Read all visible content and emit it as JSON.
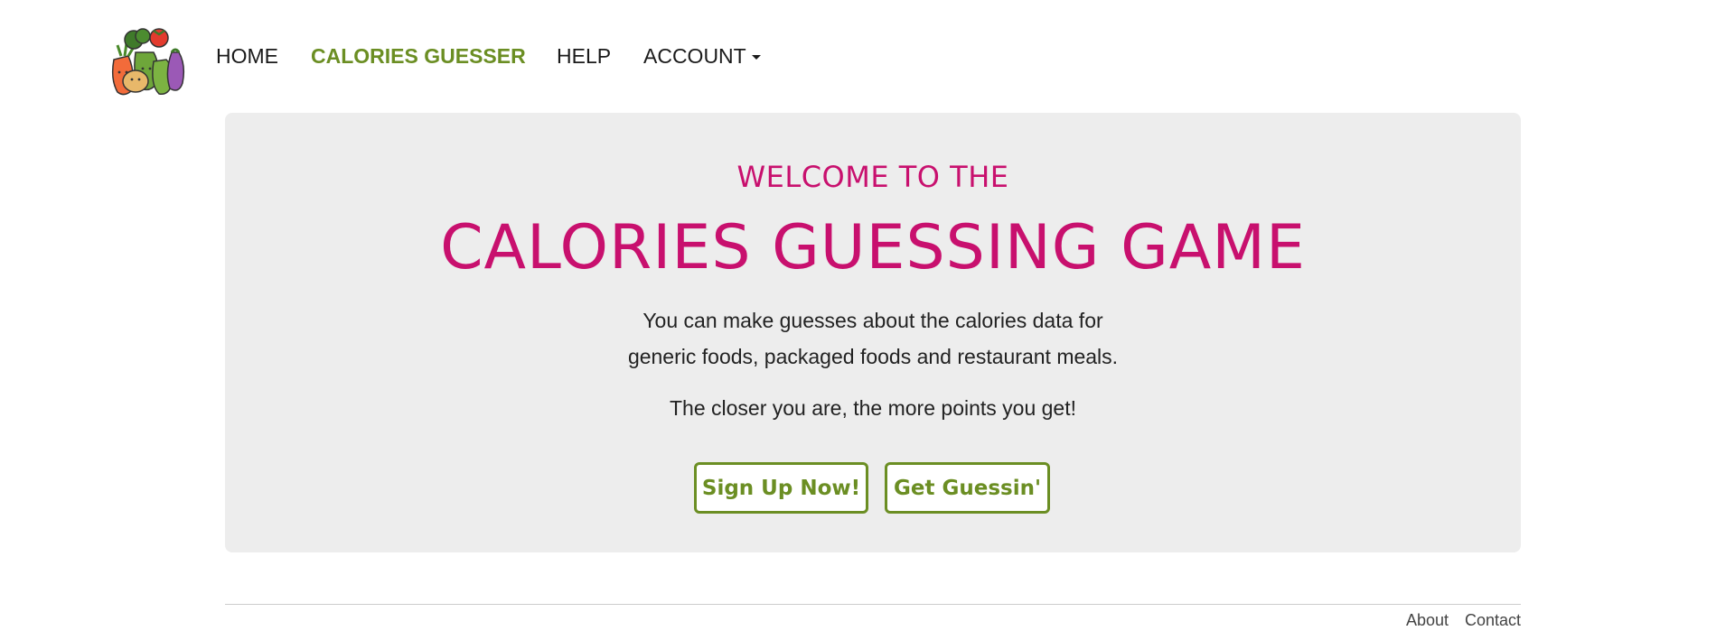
{
  "nav": {
    "logo_icon": "vegetables-logo-icon",
    "items": [
      {
        "label": "HOME",
        "active": false
      },
      {
        "label": "CALORIES GUESSER",
        "active": true
      },
      {
        "label": "HELP",
        "active": false
      },
      {
        "label": "ACCOUNT",
        "active": false,
        "has_dropdown": true
      }
    ]
  },
  "hero": {
    "welcome": "WELCOME TO THE",
    "title": "CALORIES GUESSING GAME",
    "description_line1": "You can make guesses about the calories data for",
    "description_line2": "generic foods, packaged foods and restaurant meals.",
    "tagline": "The closer you are, the more points you get!",
    "buttons": {
      "signup": "Sign Up Now!",
      "guess": "Get Guessin'"
    }
  },
  "footer": {
    "links": [
      "About",
      "Contact"
    ]
  },
  "colors": {
    "brand_pink": "#c8106e",
    "brand_green": "#6b8e23",
    "panel_bg": "#ededed"
  }
}
